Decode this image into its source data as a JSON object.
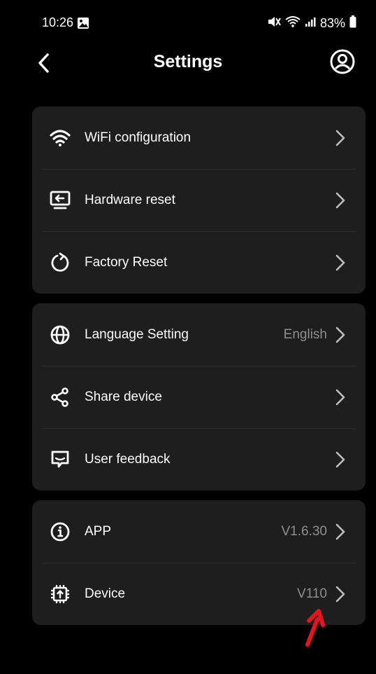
{
  "status_bar": {
    "time": "10:26",
    "battery": "83%"
  },
  "header": {
    "title": "Settings"
  },
  "groups": [
    {
      "items": [
        {
          "label": "WiFi configuration",
          "icon": "wifi-icon",
          "value": ""
        },
        {
          "label": "Hardware reset",
          "icon": "hardware-reset-icon",
          "value": ""
        },
        {
          "label": "Factory Reset",
          "icon": "refresh-icon",
          "value": ""
        }
      ]
    },
    {
      "items": [
        {
          "label": "Language Setting",
          "icon": "globe-icon",
          "value": "English"
        },
        {
          "label": "Share device",
          "icon": "share-icon",
          "value": ""
        },
        {
          "label": "User feedback",
          "icon": "feedback-icon",
          "value": ""
        }
      ]
    },
    {
      "items": [
        {
          "label": "APP",
          "icon": "info-icon",
          "value": "V1.6.30"
        },
        {
          "label": "Device",
          "icon": "chip-icon",
          "value": "V110"
        }
      ]
    }
  ],
  "colors": {
    "background": "#000000",
    "card": "#1e1e1e",
    "value_text": "#8e8e8e",
    "annotation_arrow": "#e8141c"
  }
}
